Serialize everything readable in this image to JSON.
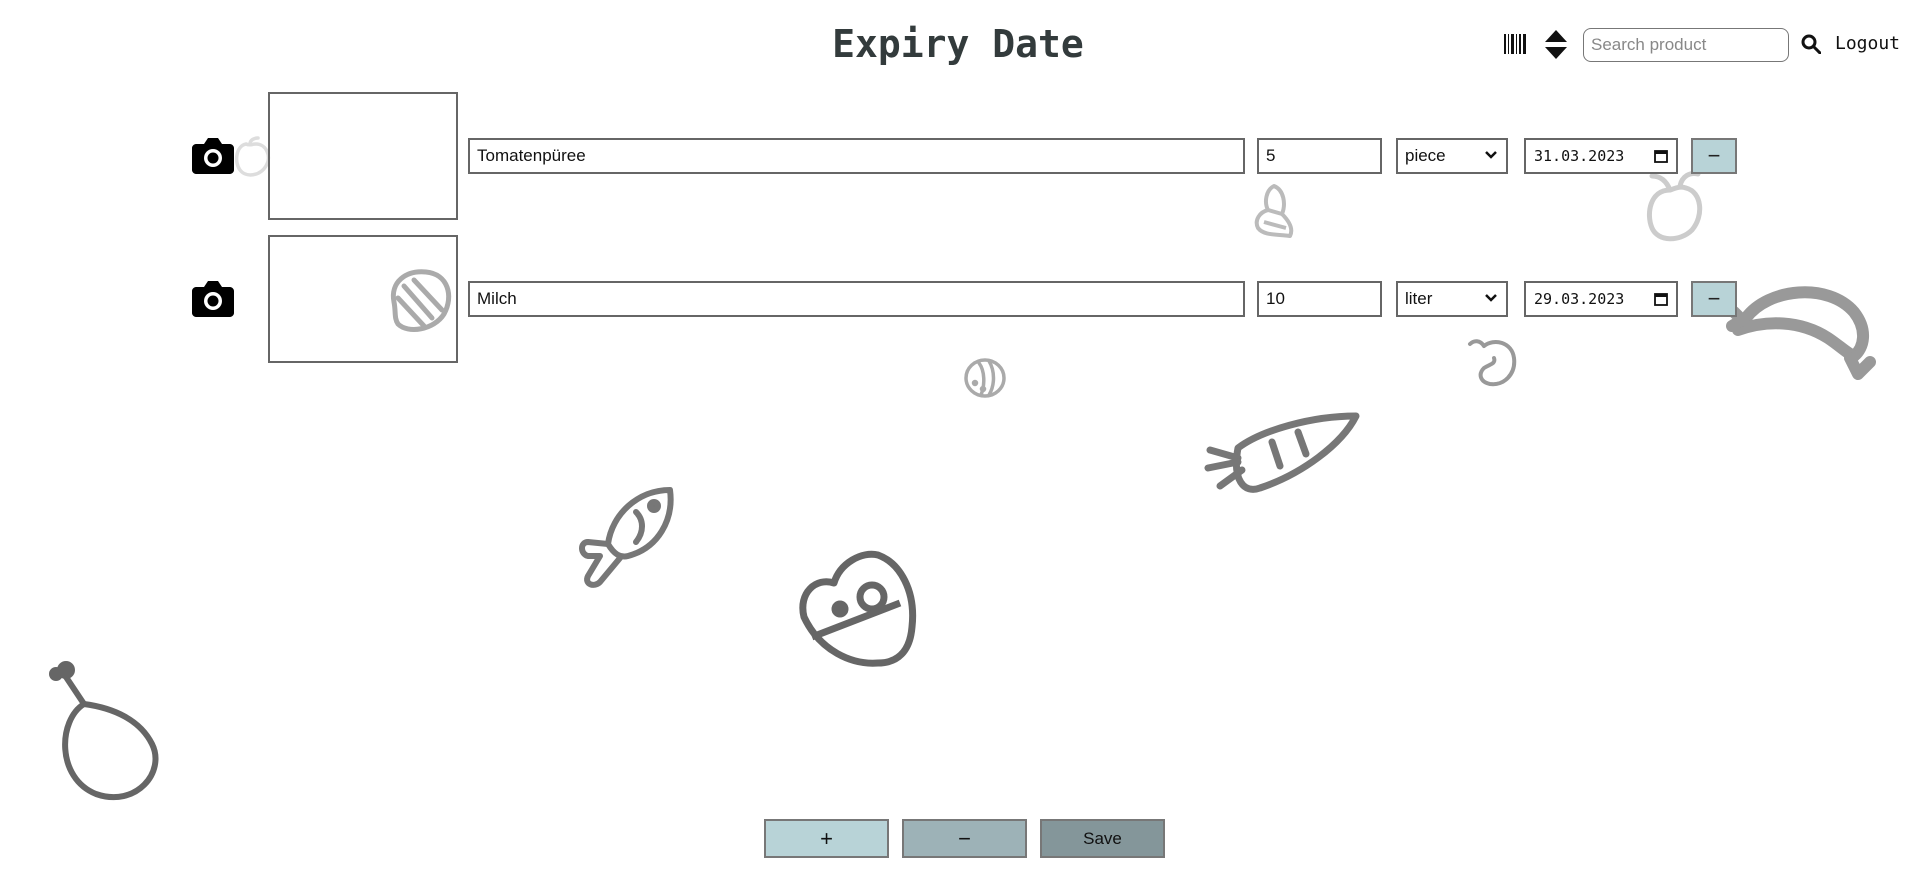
{
  "header": {
    "title": "Expiry Date",
    "search_placeholder": "Search product",
    "search_value": "",
    "logout_label": "Logout",
    "icons": [
      "barcode-icon",
      "sort-icon",
      "search-icon"
    ]
  },
  "products": [
    {
      "name": "Tomatenpüree",
      "quantity": "5",
      "unit": "piece",
      "date": "31.03.2023"
    },
    {
      "name": "Milch",
      "quantity": "10",
      "unit": "liter",
      "date": "29.03.2023"
    }
  ],
  "row_remove_label": "−",
  "actions": {
    "add_label": "+",
    "remove_label": "−",
    "save_label": "Save"
  },
  "colors": {
    "accent_light": "#b8d3d7",
    "accent_mid": "#9db2b7",
    "accent_dark": "#84969a",
    "title": "#333b3c"
  },
  "background_doodles": [
    "drumstick-doodle",
    "fish-doodle",
    "cheese-doodle",
    "carrot-doodle",
    "sausage-doodle",
    "steak-doodle",
    "croissant-doodle",
    "potato-doodle",
    "cookie-doodle",
    "pepper-doodle",
    "bell-pepper-doodle"
  ]
}
